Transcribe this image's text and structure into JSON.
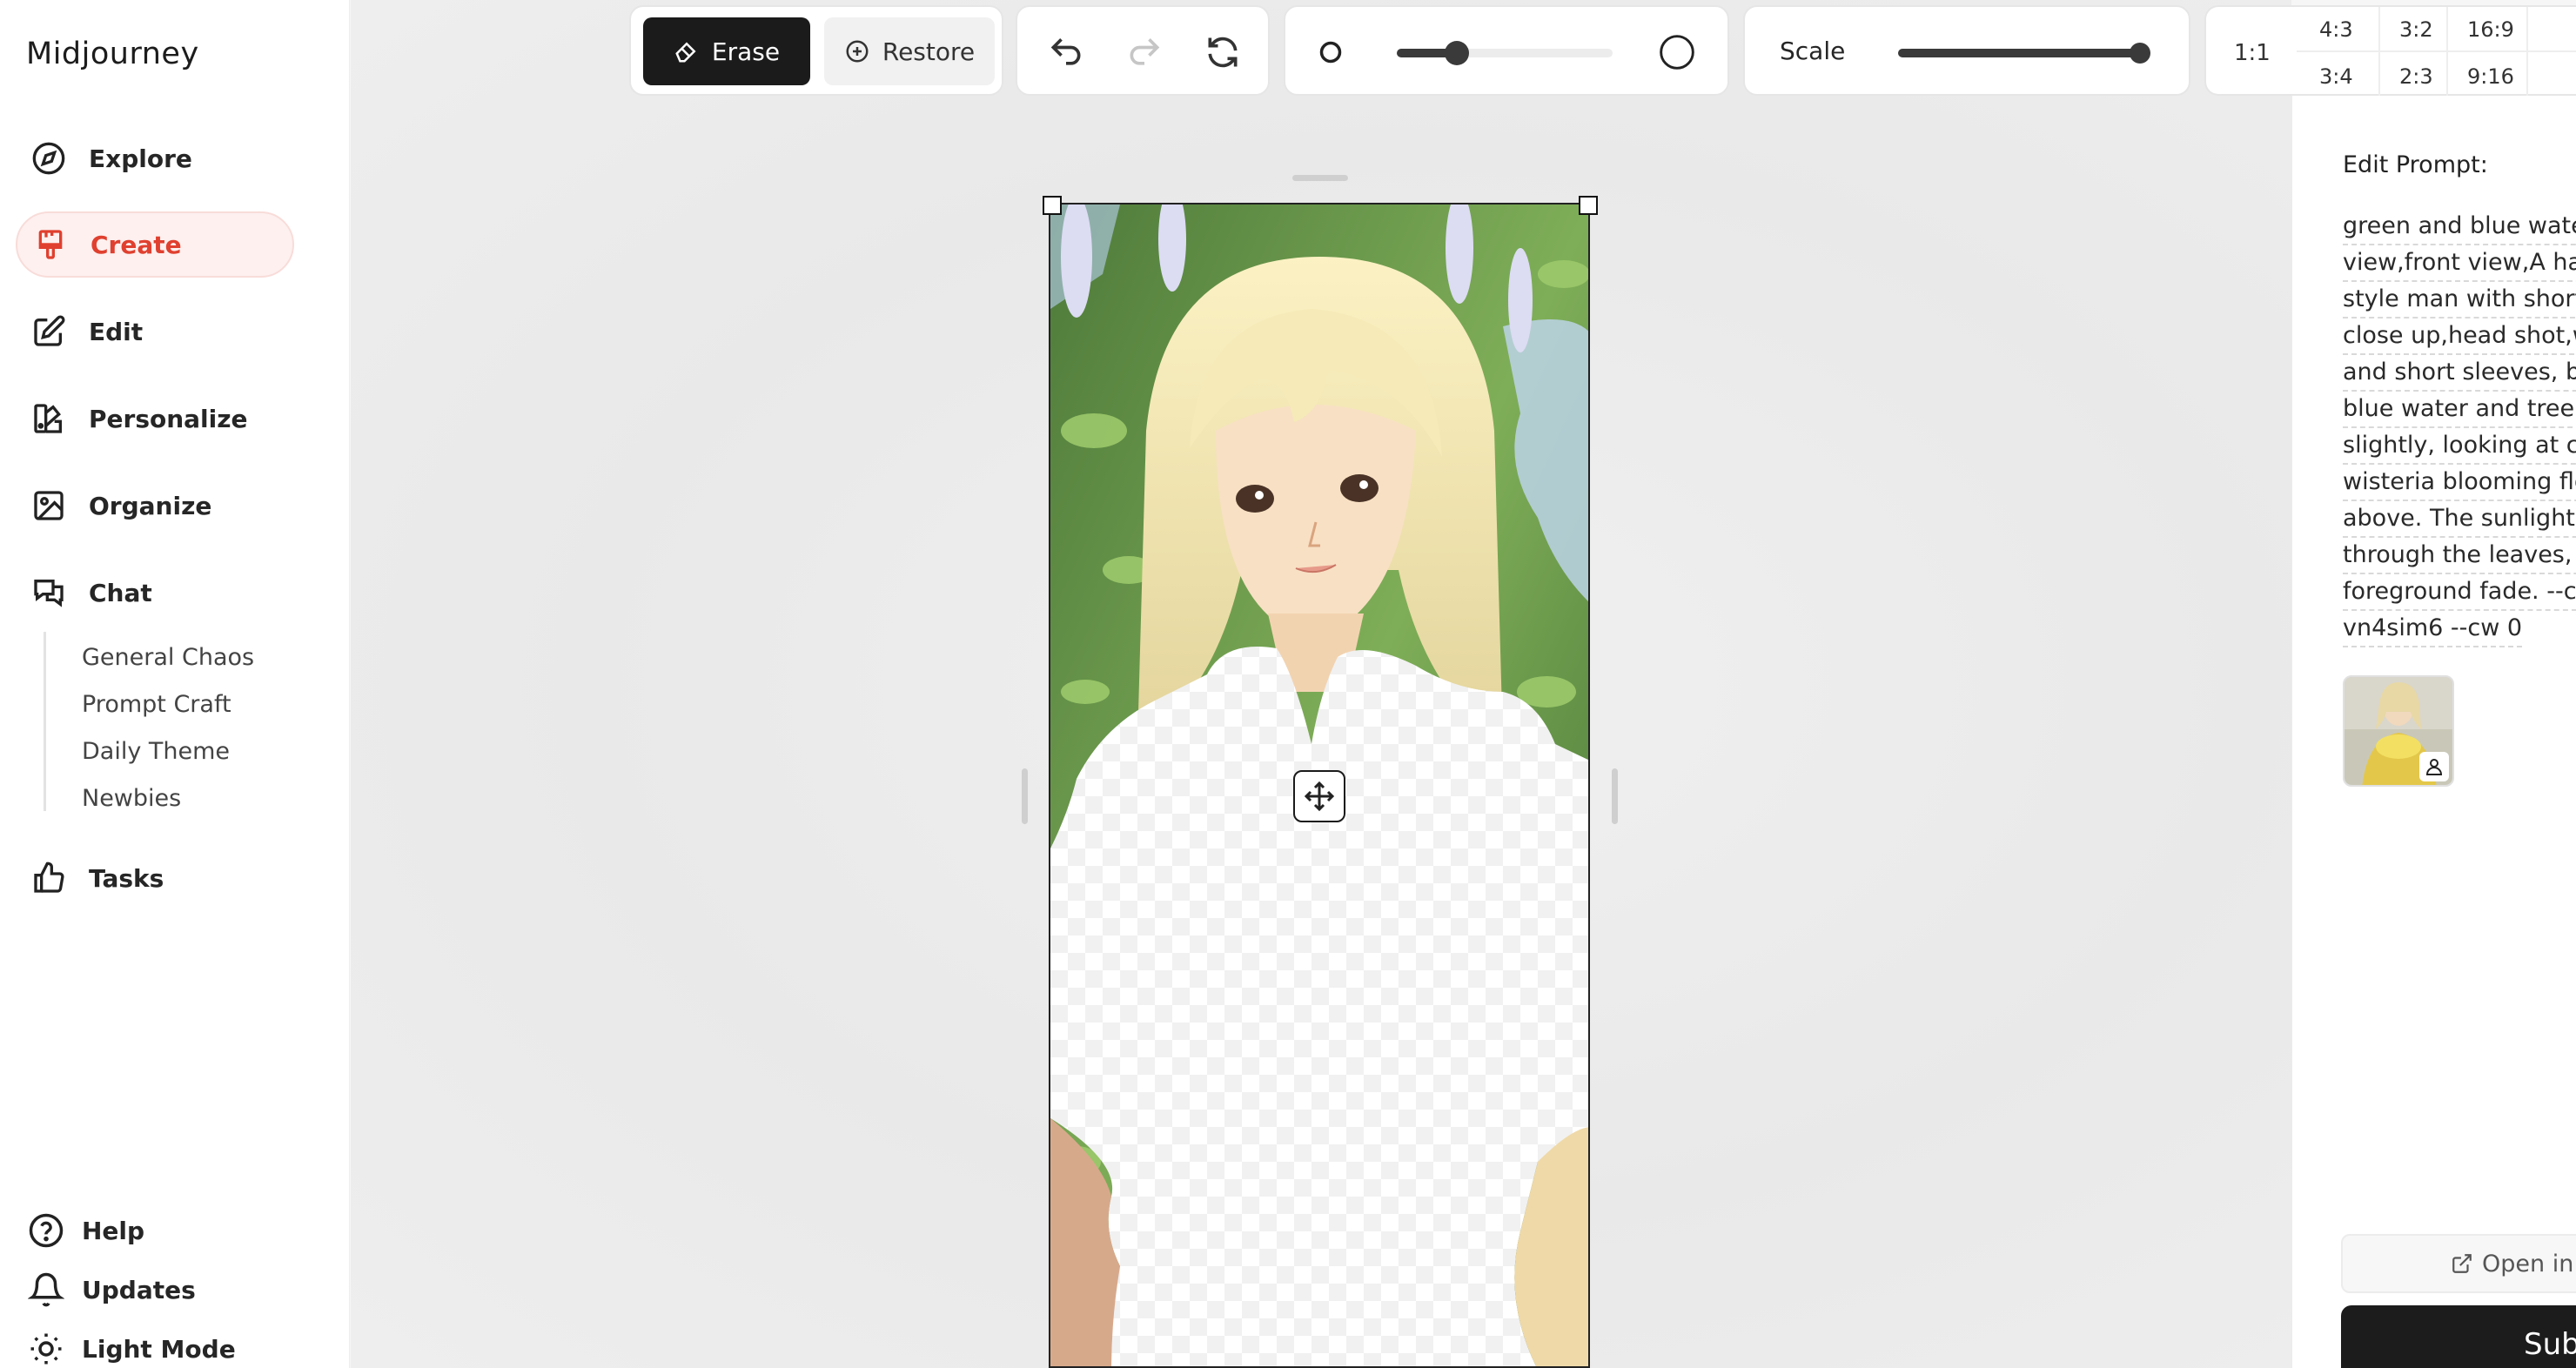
{
  "sidebar": {
    "brand": "Midjourney",
    "nav": [
      {
        "label": "Explore",
        "icon": "compass-icon"
      },
      {
        "label": "Create",
        "icon": "paintbrush-icon",
        "active": true
      },
      {
        "label": "Edit",
        "icon": "edit-icon"
      },
      {
        "label": "Personalize",
        "icon": "palette-icon"
      },
      {
        "label": "Organize",
        "icon": "image-icon"
      },
      {
        "label": "Chat",
        "icon": "chat-icon"
      }
    ],
    "chat_rooms": [
      "General Chaos",
      "Prompt Craft",
      "Daily Theme",
      "Newbies"
    ],
    "tasks": {
      "label": "Tasks",
      "icon": "thumbs-up-icon"
    },
    "footer": [
      {
        "label": "Help",
        "icon": "help-icon"
      },
      {
        "label": "Updates",
        "icon": "bell-icon"
      },
      {
        "label": "Light Mode",
        "icon": "sun-icon"
      }
    ]
  },
  "toolbar": {
    "erase_label": "Erase",
    "restore_label": "Restore",
    "brush_size_level": 0.25,
    "scale_label": "Scale",
    "scale_level": 1.0,
    "ratio_single": "1:1",
    "ratios_top": [
      "4:3",
      "3:2",
      "16:9"
    ],
    "ratios_bottom": [
      "3:4",
      "2:3",
      "9:16"
    ]
  },
  "prompt_panel": {
    "label": "Edit Prompt:",
    "lines": [
      "green and blue water,",
      "view,front view,A handsome",
      "style man with short",
      "close up,head shot,w",
      "and short sleeves, ba",
      "blue water and tree,f",
      "slightly, looking at ca",
      "wisteria blooming flo",
      "above. The sunlight s",
      "through the leaves, V",
      "foreground fade. --c",
      "vn4sim6 --cw 0"
    ],
    "open_in_label": "Open in",
    "submit_label": "Submit"
  },
  "colors": {
    "accent": "#e0402f",
    "active_bg": "#fdf0ef",
    "dark": "#1b1b1b"
  }
}
